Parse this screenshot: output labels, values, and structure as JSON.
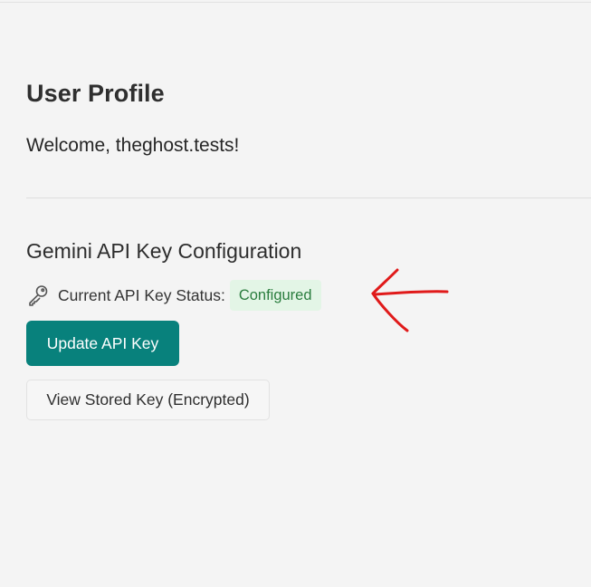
{
  "page": {
    "title": "User Profile",
    "welcome": "Welcome, theghost.tests!"
  },
  "api_section": {
    "title": "Gemini API Key Configuration",
    "status_icon": "key-icon",
    "status_label": "Current API Key Status:",
    "status_value": "Configured",
    "update_button": "Update API Key",
    "view_button": "View Stored Key (Encrypted)"
  },
  "colors": {
    "primary_button": "#08817c",
    "status_badge_bg": "#e3f5e6",
    "status_badge_text": "#2a7d3e",
    "annotation": "#e01a1a",
    "page_background": "#f4f4f4"
  },
  "annotation": {
    "icon": "red-arrow-icon"
  }
}
